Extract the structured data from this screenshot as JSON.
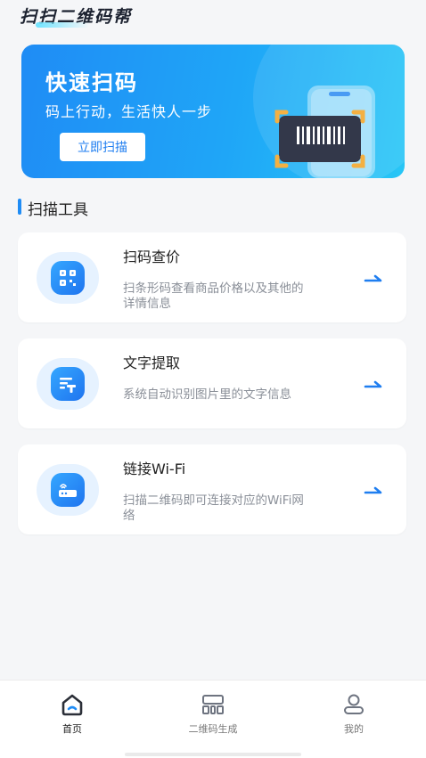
{
  "app": {
    "title": "扫扫二维码帮"
  },
  "banner": {
    "title": "快速扫码",
    "subtitle": "码上行动，生活快人一步",
    "button_label": "立即扫描"
  },
  "section": {
    "title": "扫描工具"
  },
  "tools": [
    {
      "title": "扫码查价",
      "description": "扫条形码查看商品价格以及其他的详情信息",
      "icon": "qr-price-icon"
    },
    {
      "title": "文字提取",
      "description": "系统自动识别图片里的文字信息",
      "icon": "text-extract-icon"
    },
    {
      "title": "链接Wi-Fi",
      "description": "扫描二维码即可连接对应的WiFi网络",
      "icon": "wifi-router-icon"
    }
  ],
  "nav": {
    "items": [
      {
        "label": "首页",
        "icon": "home-icon",
        "active": true
      },
      {
        "label": "二维码生成",
        "icon": "qr-generate-icon",
        "active": false
      },
      {
        "label": "我的",
        "icon": "user-icon",
        "active": false
      }
    ]
  },
  "colors": {
    "accent": "#1f8cf5",
    "background": "#f5f6f8",
    "card": "#ffffff"
  }
}
